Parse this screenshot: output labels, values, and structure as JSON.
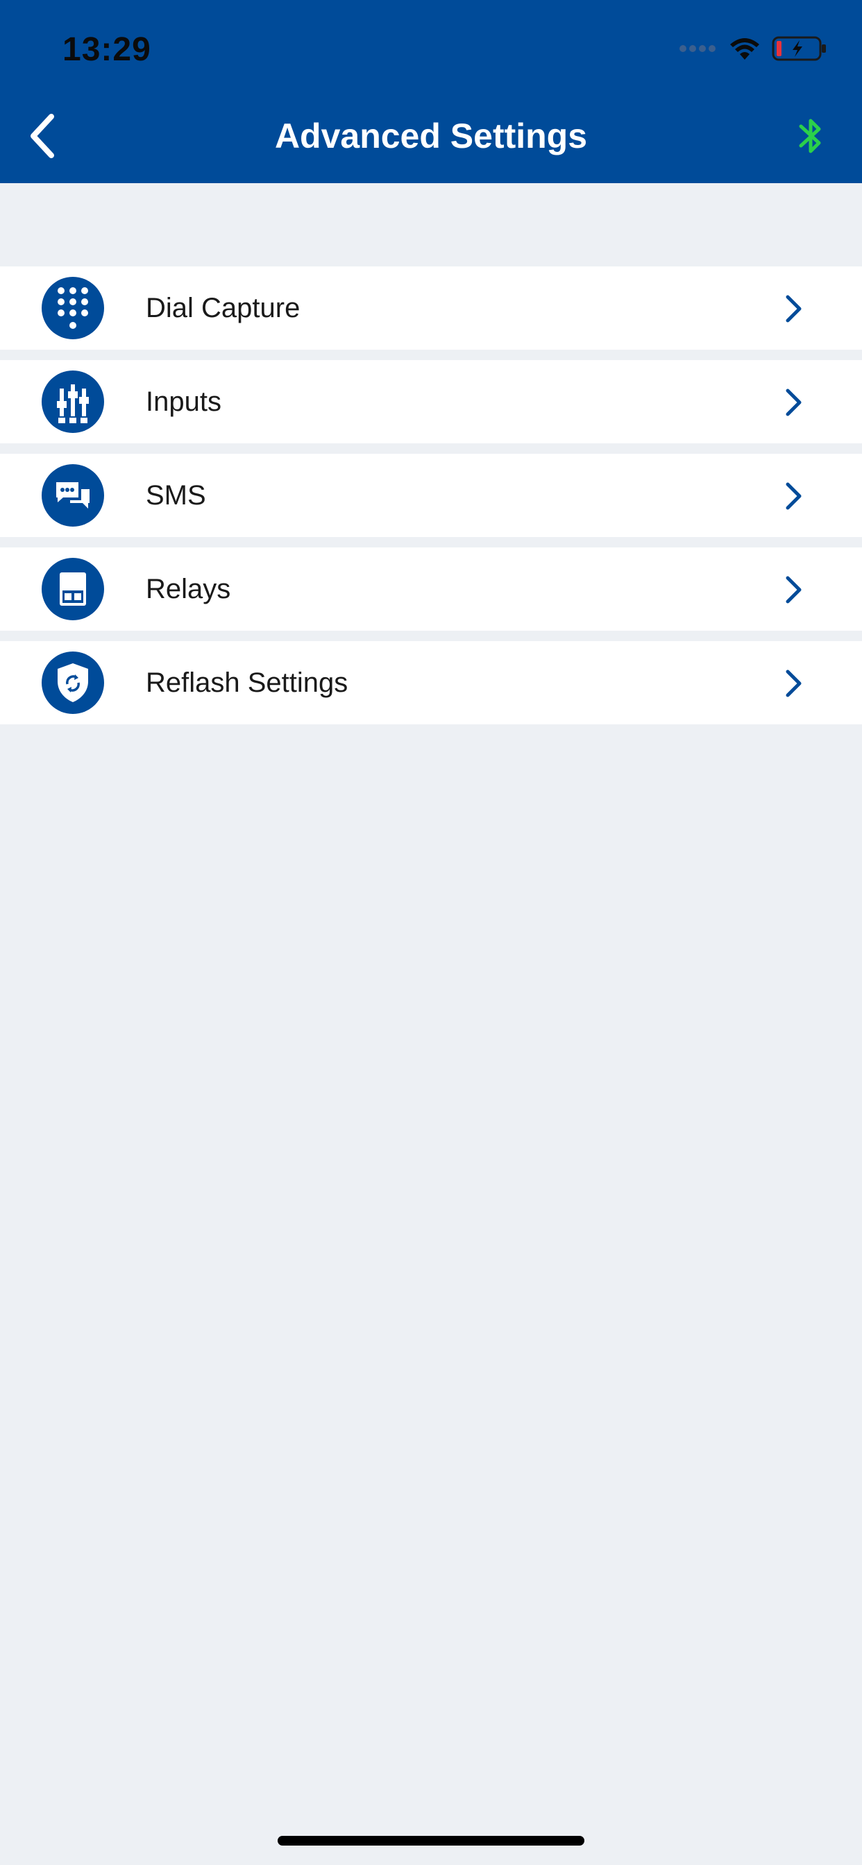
{
  "status_bar": {
    "time": "13:29"
  },
  "nav": {
    "title": "Advanced Settings",
    "back_icon": "chevron-left-icon",
    "bluetooth_icon": "bluetooth-icon"
  },
  "menu": {
    "items": [
      {
        "label": "Dial Capture",
        "icon": "dialpad-icon"
      },
      {
        "label": "Inputs",
        "icon": "inputs-icon"
      },
      {
        "label": "SMS",
        "icon": "sms-icon"
      },
      {
        "label": "Relays",
        "icon": "relays-icon"
      },
      {
        "label": "Reflash Settings",
        "icon": "reflash-shield-icon"
      }
    ]
  },
  "colors": {
    "primary": "#004b99",
    "background": "#edf0f4",
    "bluetooth": "#2bd04a",
    "battery_low": "#e8323c"
  }
}
